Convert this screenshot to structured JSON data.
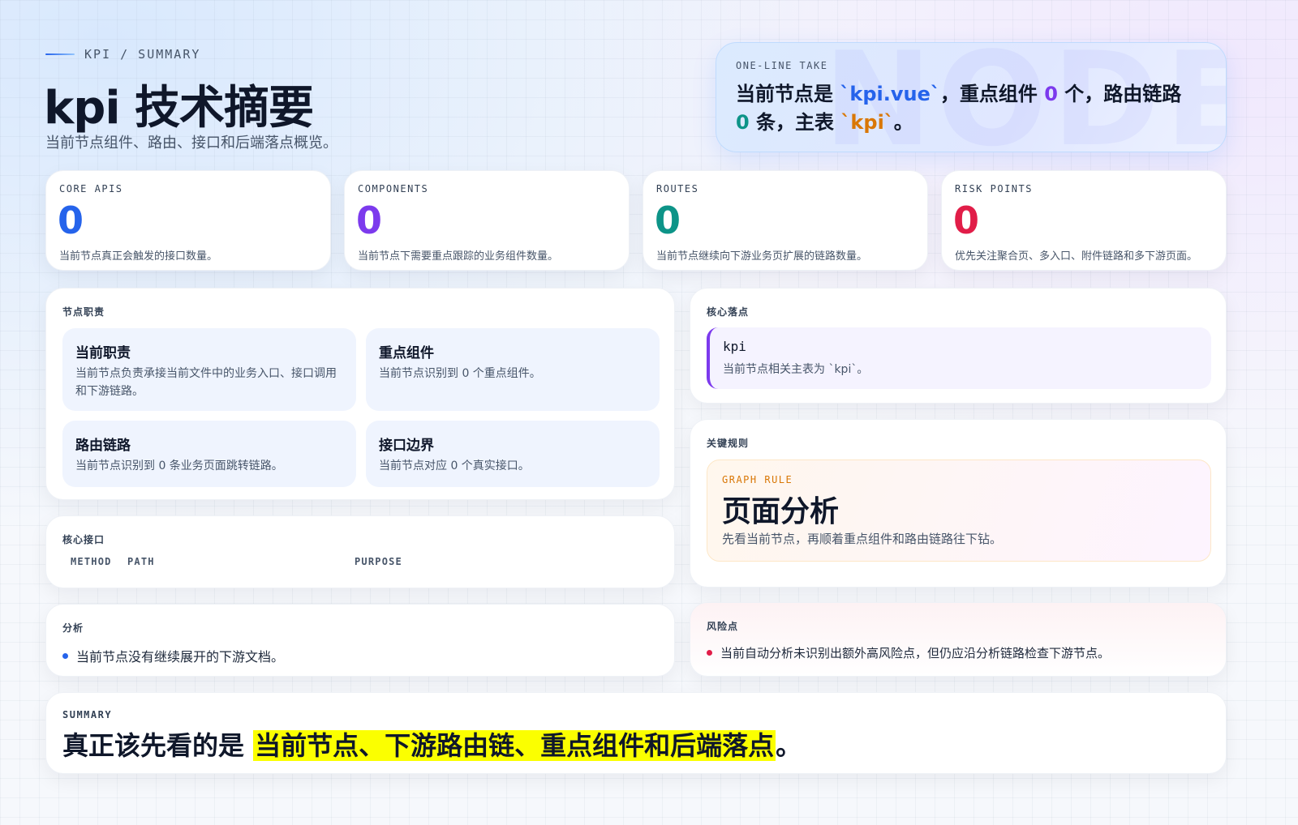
{
  "header": {
    "eyebrow": "KPI / SUMMARY",
    "title": "kpi 技术摘要",
    "subtitle": "当前节点组件、路由、接口和后端落点概览。"
  },
  "take": {
    "label": "ONE-LINE TAKE",
    "watermark": "NODE",
    "text_1": "当前节点是 ",
    "file": "`kpi.vue`",
    "text_2": "，重点组件 ",
    "components": "0",
    "text_3": " 个，路由链路 ",
    "routes": "0",
    "text_4": " 条，主表 ",
    "table": "`kpi`",
    "text_5": "。"
  },
  "stats": [
    {
      "label": "CORE APIS",
      "value": "0",
      "desc": "当前节点真正会触发的接口数量。",
      "color": "#2563eb"
    },
    {
      "label": "COMPONENTS",
      "value": "0",
      "desc": "当前节点下需要重点跟踪的业务组件数量。",
      "color": "#7c3aed"
    },
    {
      "label": "ROUTES",
      "value": "0",
      "desc": "当前节点继续向下游业务页扩展的链路数量。",
      "color": "#0d9488"
    },
    {
      "label": "RISK POINTS",
      "value": "0",
      "desc": "优先关注聚合页、多入口、附件链路和多下游页面。",
      "color": "#e11d48"
    }
  ],
  "duties": {
    "label": "节点职责",
    "items": [
      {
        "title": "当前职责",
        "desc": "当前节点负责承接当前文件中的业务入口、接口调用和下游链路。"
      },
      {
        "title": "重点组件",
        "desc": "当前节点识别到 0 个重点组件。"
      },
      {
        "title": "路由链路",
        "desc": "当前节点识别到 0 条业务页面跳转链路。"
      },
      {
        "title": "接口边界",
        "desc": "当前节点对应 0 个真实接口。"
      }
    ]
  },
  "landing": {
    "label": "核心落点",
    "name": "kpi",
    "desc": "当前节点相关主表为 `kpi`。"
  },
  "rules": {
    "label": "关键规则",
    "tag": "GRAPH RULE",
    "title": "页面分析",
    "desc": "先看当前节点，再顺着重点组件和路由链路往下钻。"
  },
  "apis": {
    "label": "核心接口",
    "columns": [
      "METHOD",
      "PATH",
      "PURPOSE"
    ]
  },
  "analysis": {
    "label": "分析",
    "items": [
      "当前节点没有继续展开的下游文档。"
    ],
    "dot_color": "#2563eb"
  },
  "risks": {
    "label": "风险点",
    "items": [
      "当前自动分析未识别出额外高风险点，但仍应沿分析链路检查下游节点。"
    ],
    "dot_color": "#e11d48"
  },
  "summary": {
    "label": "SUMMARY",
    "lead": "真正该先看的是 ",
    "highlight": "当前节点、下游路由链、重点组件和后端落点",
    "end": "。"
  }
}
